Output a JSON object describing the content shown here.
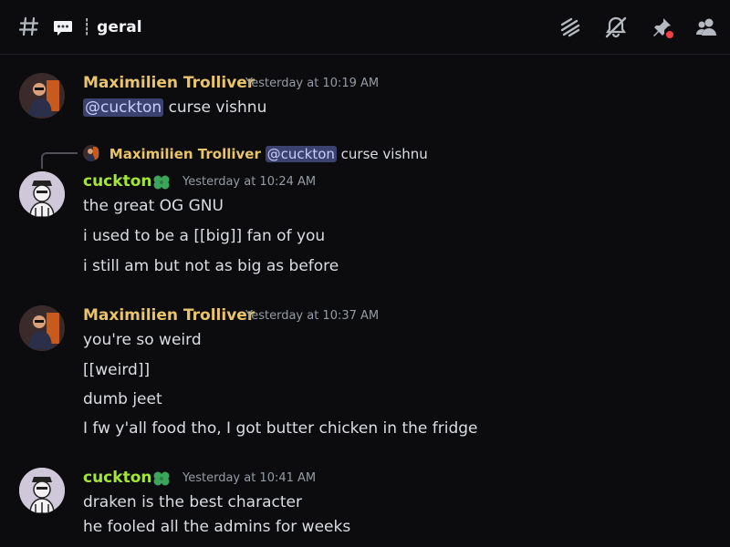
{
  "header": {
    "channel_prefix_icon": "hash-icon",
    "channel_emoji_icon": "speech-bubble-icon",
    "channel_name": "┊ geral",
    "icons": [
      "threads-icon",
      "mute-bell-icon",
      "pinned-icon",
      "members-icon"
    ]
  },
  "colors": {
    "maximilien": "#e9c46a",
    "cuckton": "#a3e635",
    "mention_bg": "#3c4270",
    "timestamp": "#949ba4"
  },
  "messages": [
    {
      "author": "Maximilien Trolliver",
      "timestamp": "Yesterday at 10:19 AM",
      "mention": "@cuckton",
      "text": "curse vishnu"
    },
    {
      "reply": {
        "author": "Maximilien Trolliver",
        "mention": "@cuckton",
        "text": "curse vishnu"
      },
      "author": "cuckton",
      "badge_icon": "clover-icon",
      "timestamp": "Yesterday at 10:24 AM",
      "lines": [
        "the great OG GNU",
        "i used to be a [[big]] fan of you",
        "i still am but not as big as before"
      ]
    },
    {
      "author": "Maximilien Trolliver",
      "timestamp": "Yesterday at 10:37 AM",
      "lines": [
        "you're so weird",
        "[[weird]]",
        "dumb jeet",
        "I fw y'all food tho, I got butter chicken in the fridge"
      ]
    },
    {
      "author": "cuckton",
      "badge_icon": "clover-icon",
      "timestamp": "Yesterday at 10:41 AM",
      "lines": [
        "draken is the best character",
        "he fooled all the admins for weeks"
      ]
    }
  ]
}
